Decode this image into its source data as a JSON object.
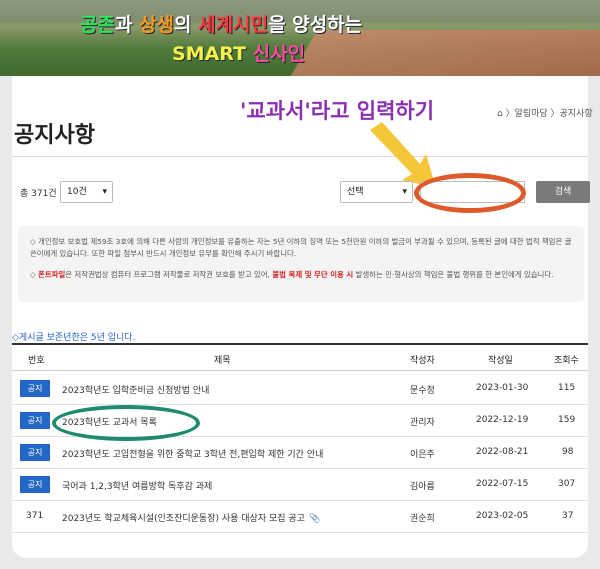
{
  "banner": {
    "line1": [
      {
        "text": "공존",
        "color": "#2ee65a"
      },
      {
        "text": "과 ",
        "color": "#ffffff"
      },
      {
        "text": "상생",
        "color": "#ff9a1a"
      },
      {
        "text": "의 ",
        "color": "#ffffff"
      },
      {
        "text": "세계시민",
        "color": "#ff3a3a"
      },
      {
        "text": "을 양성하는",
        "color": "#ffffff"
      }
    ],
    "line2": [
      {
        "text": "SMART ",
        "color": "#f4f14a"
      },
      {
        "text": "신사인",
        "color": "#ff4aa0"
      }
    ]
  },
  "annotation": {
    "instruction": "'교과서'라고 입력하기"
  },
  "header": {
    "breadcrumb": "⌂ 〉알림마당 〉공지사항",
    "title": "공지사항"
  },
  "search": {
    "count_label": "총 371건",
    "rows_select": "10건",
    "field_select": "선택",
    "input_value": "",
    "button_label": "검색"
  },
  "notice": {
    "p1": "◇ 개인정보 보호법 제59조 3호에 의해 다른 사람의 개인정보를 유출하는 자는 5년 이하의 징역 또는 5천만원 이하의 벌금이 부과될 수 있으며, 등록된 글에 대한 법적 책임은 글쓴이에게 있습니다. 또한 파일 첨부시 반드시 개인정보 유무를 확인해 주시기 바랍니다.",
    "p2_prefix": "◇ ",
    "p2_highlight1": "폰트파일",
    "p2_mid": "은 저작권법상 컴퓨터 프로그램 저작물로 저작권 보호를 받고 있어, ",
    "p2_highlight2": "불법 복제 및 무단 이용 시",
    "p2_suffix": " 발생하는 민·형사상의 책임은 불법 행위를 한 본인에게 있습니다."
  },
  "retention_notice": "◇게시글 보존년한은 5년 입니다.",
  "table": {
    "headers": {
      "no": "번호",
      "title": "제목",
      "author": "작성자",
      "date": "작성일",
      "views": "조회수"
    },
    "rows": [
      {
        "badge": "공지",
        "title": "2023학년도 입학준비금 신청방법 안내",
        "author": "문수정",
        "date": "2023-01-30",
        "views": "115"
      },
      {
        "badge": "공지",
        "title": "2023학년도 교과서 목록",
        "author": "관리자",
        "date": "2022-12-19",
        "views": "159"
      },
      {
        "badge": "공지",
        "title": "2023학년도 고입전형을 위한 중학교 3학년 전,편입학 제한 기간 안내",
        "author": "이은주",
        "date": "2022-08-21",
        "views": "98"
      },
      {
        "badge": "공지",
        "title": "국어과 1,2,3학년 여름방학 독후감 과제",
        "author": "김아름",
        "date": "2022-07-15",
        "views": "307"
      },
      {
        "number": "371",
        "title": "2023년도 학교체육시설(인조잔디운동장) 사용 대상자 모집 공고",
        "author": "권순희",
        "date": "2023-02-05",
        "views": "37"
      }
    ]
  }
}
